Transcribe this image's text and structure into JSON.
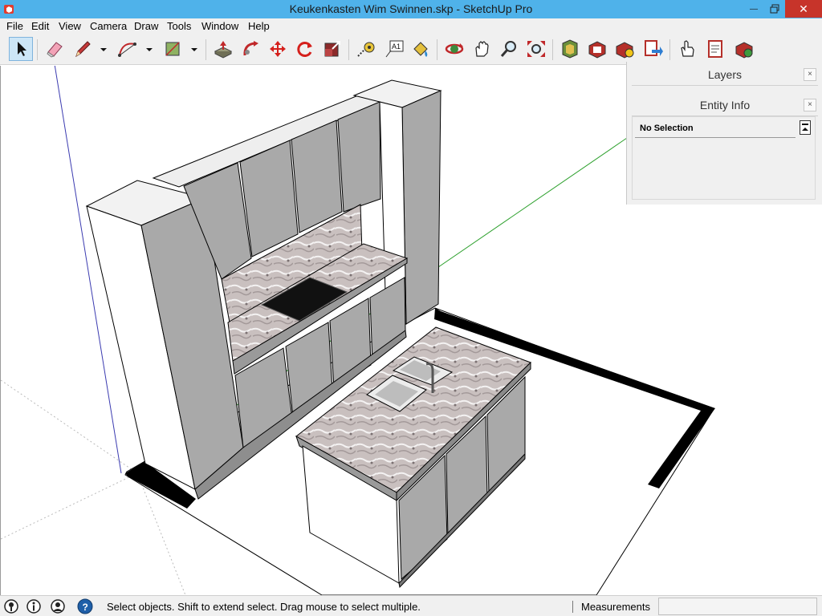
{
  "window": {
    "title": "Keukenkasten Wim Swinnen.skp - SketchUp Pro",
    "minimize_glyph": "—",
    "close_glyph": "✕"
  },
  "menu": [
    "File",
    "Edit",
    "View",
    "Camera",
    "Draw",
    "Tools",
    "Window",
    "Help"
  ],
  "toolbar": {
    "tools": [
      "select-icon",
      "eraser-icon",
      "pencil-icon",
      "arc-icon",
      "rectangle-icon",
      "push-pull-icon",
      "follow-me-icon",
      "move-icon",
      "rotate-icon",
      "scale-icon",
      "tape-measure-icon",
      "text-icon",
      "paint-bucket-icon",
      "orbit-icon",
      "pan-icon",
      "zoom-icon",
      "zoom-extents-icon",
      "3d-warehouse-icon",
      "extension-warehouse-icon",
      "send-to-layout-icon",
      "extension-manager-icon",
      "interact-icon",
      "report-icon",
      "generate-report-icon"
    ],
    "text_tool_glyph": "A1"
  },
  "tray": {
    "layers_title": "Layers",
    "entity_info_title": "Entity Info",
    "close_glyph": "×",
    "selection_status": "No Selection"
  },
  "status": {
    "help_text": "Select objects. Shift to extend select. Drag mouse to select multiple.",
    "measurements_label": "Measurements",
    "measurements_value": ""
  },
  "colors": {
    "titlebar": "#4fb2ea",
    "close_button": "#c7342a",
    "cabinet_grey": "#a9a9a9",
    "marble": "#c9c0bf"
  }
}
